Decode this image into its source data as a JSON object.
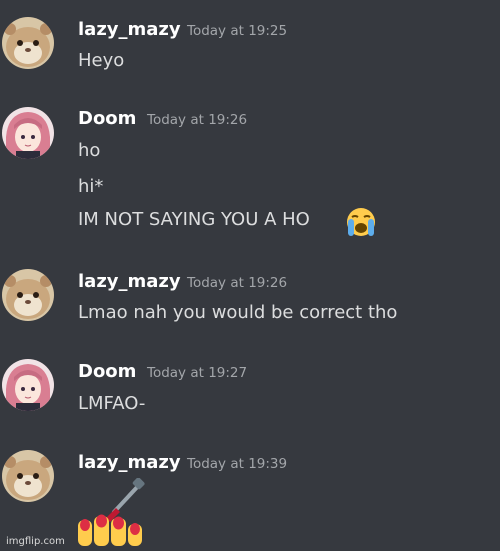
{
  "messages": [
    {
      "author": "lazy_mazy",
      "timestamp": "Today at 19:25",
      "lines": [
        "Heyo"
      ]
    },
    {
      "author": "Doom",
      "timestamp": "Today at 19:26",
      "lines": [
        "ho",
        "hi*",
        "IM NOT SAYING YOU A HO"
      ],
      "emoji": "loudly-crying-face-emoji"
    },
    {
      "author": "lazy_mazy",
      "timestamp": "Today at 19:26",
      "lines": [
        "Lmao nah you would be correct tho"
      ]
    },
    {
      "author": "Doom",
      "timestamp": "Today at 19:27",
      "lines": [
        "LMFAO-"
      ]
    },
    {
      "author": "lazy_mazy",
      "timestamp": "Today at 19:39",
      "lines": [],
      "emoji": "nail-polish-emoji"
    }
  ],
  "watermark": "imgflip.com",
  "colors": {
    "background": "#36393f",
    "username": "#ffffff",
    "timestamp": "#a3a6aa",
    "message_text": "#dcddde"
  }
}
